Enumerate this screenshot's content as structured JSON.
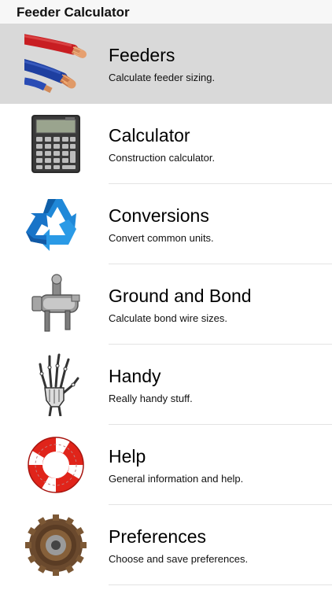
{
  "header": {
    "title": "Feeder Calculator"
  },
  "menu": {
    "items": [
      {
        "title": "Feeders",
        "subtitle": "Calculate feeder sizing.",
        "icon": "wires-icon",
        "selected": true
      },
      {
        "title": "Calculator",
        "subtitle": "Construction calculator.",
        "icon": "calculator-icon",
        "selected": false
      },
      {
        "title": "Conversions",
        "subtitle": "Convert common units.",
        "icon": "recycle-arrows-icon",
        "selected": false
      },
      {
        "title": "Ground and Bond",
        "subtitle": "Calculate bond wire sizes.",
        "icon": "ground-clamp-icon",
        "selected": false
      },
      {
        "title": "Handy",
        "subtitle": "Really handy stuff.",
        "icon": "skeleton-hand-icon",
        "selected": false
      },
      {
        "title": "Help",
        "subtitle": "General information and help.",
        "icon": "life-ring-icon",
        "selected": false
      },
      {
        "title": "Preferences",
        "subtitle": "Choose and save preferences.",
        "icon": "gear-cassette-icon",
        "selected": false
      }
    ]
  },
  "colors": {
    "selected_row": "#d9d9d9",
    "navbar_bg": "#f7f7f7",
    "separator": "#e3e3e3"
  }
}
